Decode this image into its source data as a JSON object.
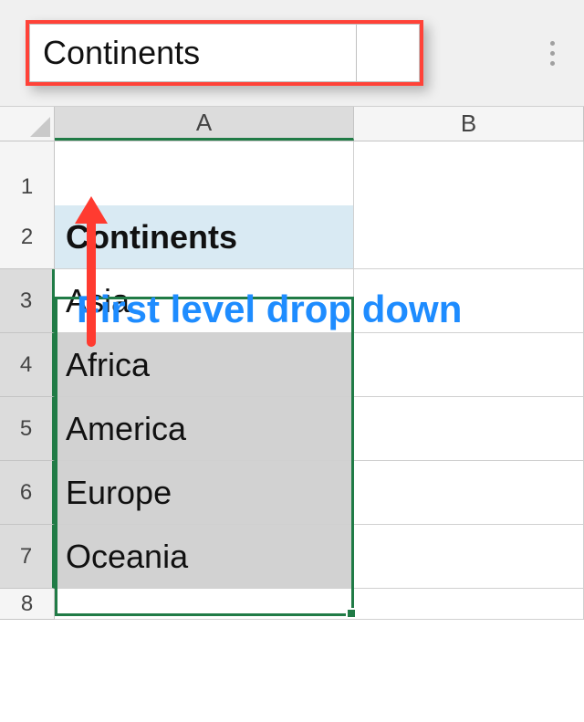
{
  "namebox": {
    "value": "Continents"
  },
  "columns": {
    "A": "A",
    "B": "B"
  },
  "rows": {
    "r1": "1",
    "r2": "2",
    "r3": "3",
    "r4": "4",
    "r5": "5",
    "r6": "6",
    "r7": "7",
    "r8": "8"
  },
  "cells": {
    "A2": "Continents",
    "A3": "Asia",
    "A4": "Africa",
    "A5": "America",
    "A6": "Europe",
    "A7": "Oceania"
  },
  "annotation": "First level drop down",
  "colors": {
    "selection_border": "#207b46",
    "highlight_red": "#ff4238",
    "annotation_blue": "#1e8cff",
    "header_fill": "#d9eaf3"
  },
  "chart_data": {
    "type": "table",
    "title": "Continents",
    "categories": [
      "Asia",
      "Africa",
      "America",
      "Europe",
      "Oceania"
    ]
  }
}
